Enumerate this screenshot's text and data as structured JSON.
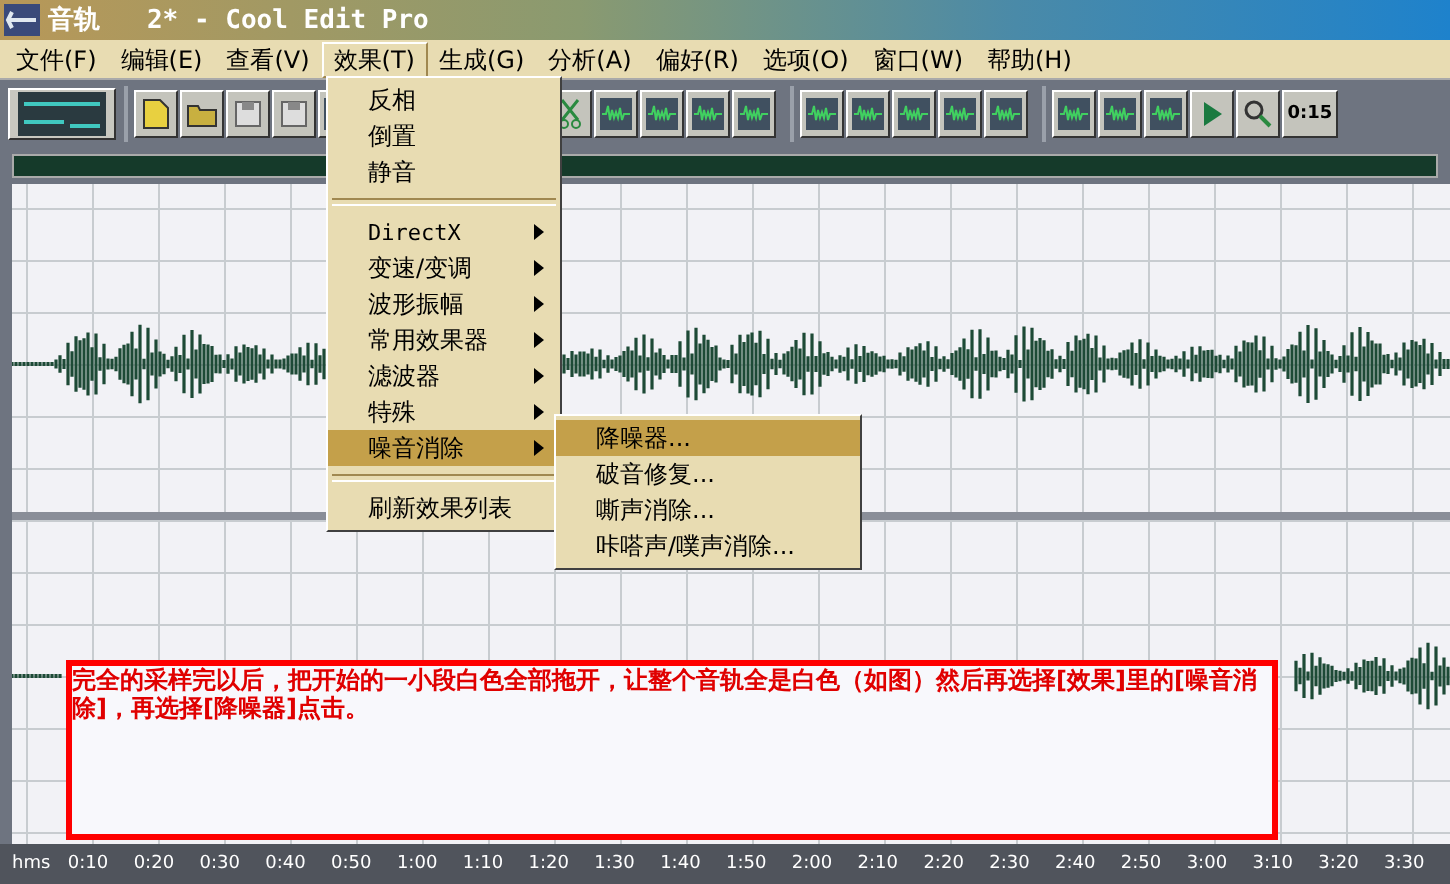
{
  "window": {
    "title": "音轨   2* - Cool Edit Pro"
  },
  "menubar": [
    {
      "label": "文件(F)",
      "selected": false
    },
    {
      "label": "编辑(E)",
      "selected": false
    },
    {
      "label": "查看(V)",
      "selected": false
    },
    {
      "label": "效果(T)",
      "selected": true
    },
    {
      "label": "生成(G)",
      "selected": false
    },
    {
      "label": "分析(A)",
      "selected": false
    },
    {
      "label": "偏好(R)",
      "selected": false
    },
    {
      "label": "选项(O)",
      "selected": false
    },
    {
      "label": "窗口(W)",
      "selected": false
    },
    {
      "label": "帮助(H)",
      "selected": false
    }
  ],
  "toolbar": {
    "time_button_label": "0:15"
  },
  "effects_menu": [
    {
      "kind": "item",
      "label": "反相",
      "selected": false
    },
    {
      "kind": "item",
      "label": "倒置",
      "selected": false
    },
    {
      "kind": "item",
      "label": "静音",
      "selected": false
    },
    {
      "kind": "separator"
    },
    {
      "kind": "submenu",
      "label": "DirectX",
      "selected": false
    },
    {
      "kind": "submenu",
      "label": "变速/变调",
      "selected": false
    },
    {
      "kind": "submenu",
      "label": "波形振幅",
      "selected": false
    },
    {
      "kind": "submenu",
      "label": "常用效果器",
      "selected": false
    },
    {
      "kind": "submenu",
      "label": "滤波器",
      "selected": false
    },
    {
      "kind": "submenu",
      "label": "特殊",
      "selected": false
    },
    {
      "kind": "submenu",
      "label": "噪音消除",
      "selected": true
    },
    {
      "kind": "separator"
    },
    {
      "kind": "item",
      "label": "刷新效果列表",
      "selected": false
    }
  ],
  "noise_submenu": [
    {
      "label": "降噪器...",
      "selected": true
    },
    {
      "label": "破音修复...",
      "selected": false
    },
    {
      "label": "嘶声消除...",
      "selected": false
    },
    {
      "label": "咔嗒声/噗声消除...",
      "selected": false
    }
  ],
  "annotation": "完全的采样完以后，把开始的一小段白色全部拖开，让整个音轨全是白色（如图）然后再选择[效果]里的[噪音消除]，再选择[降噪器]点击。",
  "ruler": {
    "unit": "hms",
    "ticks": [
      "0:10",
      "0:20",
      "0:30",
      "0:40",
      "0:50",
      "1:00",
      "1:10",
      "1:20",
      "1:30",
      "1:40",
      "1:50",
      "2:00",
      "2:10",
      "2:20",
      "2:30",
      "2:40",
      "2:50",
      "3:00",
      "3:10",
      "3:20",
      "3:30"
    ]
  }
}
